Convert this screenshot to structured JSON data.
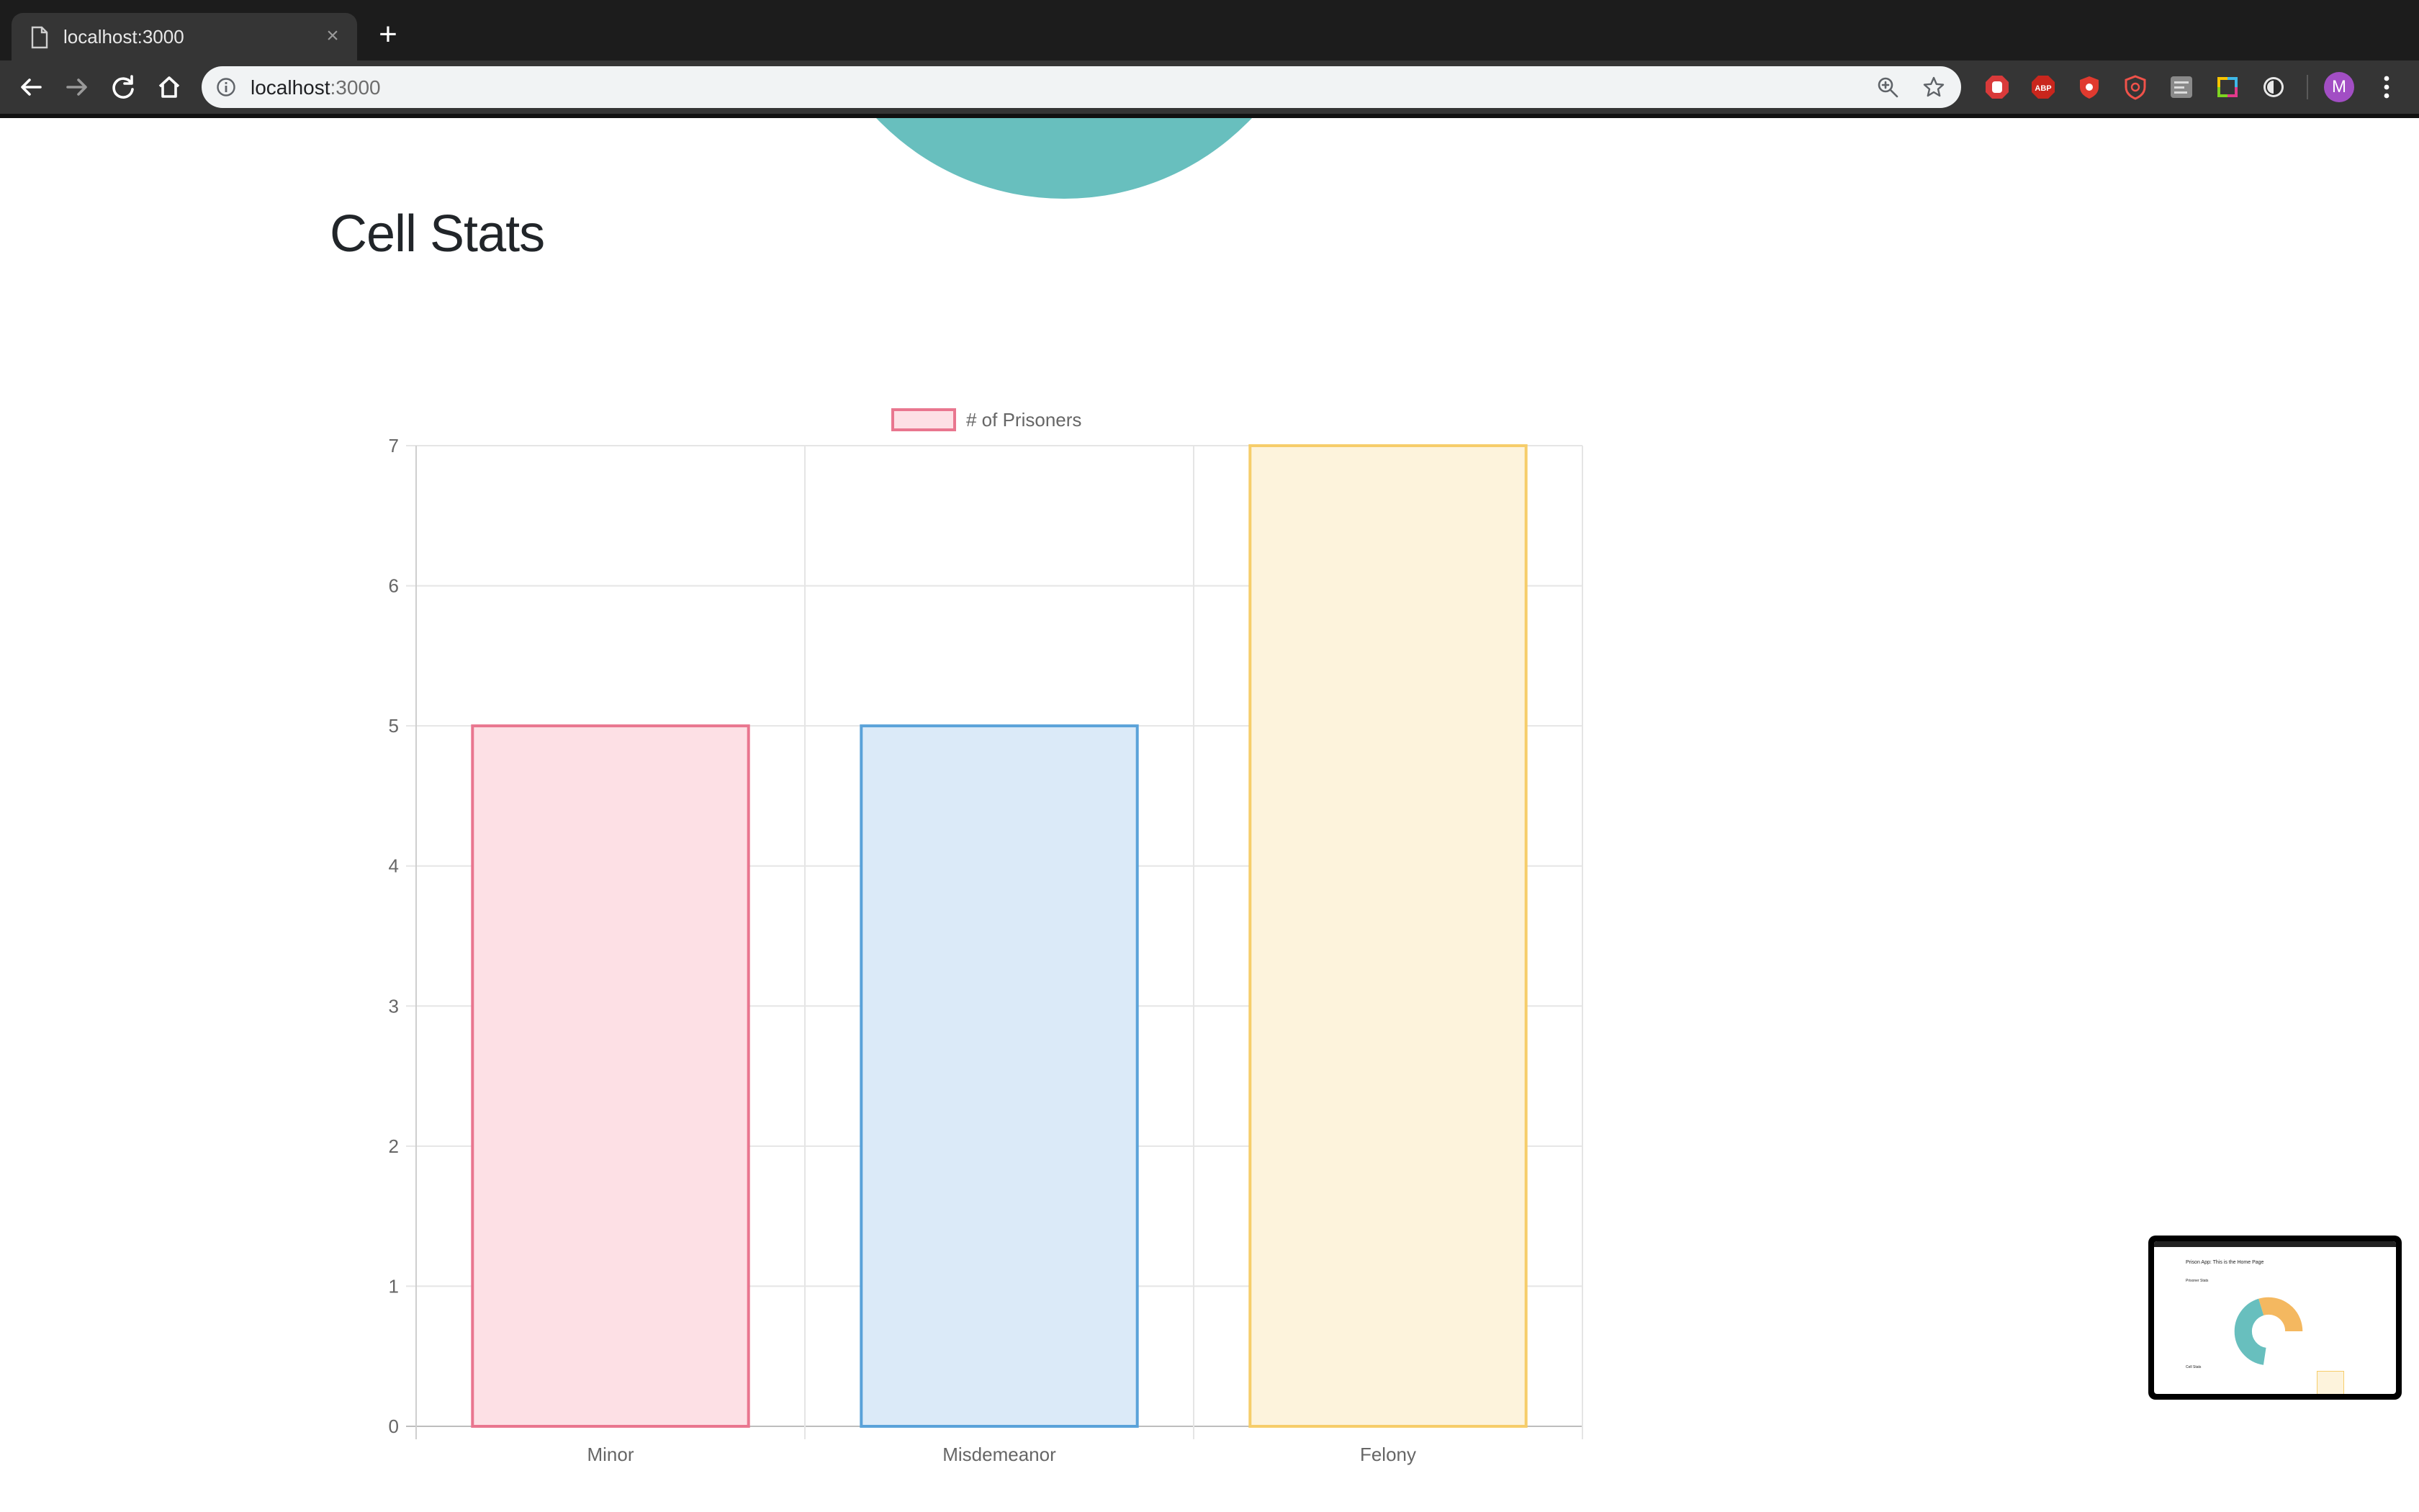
{
  "browser": {
    "tab_title": "localhost:3000",
    "url_host": "localhost",
    "url_port": ":3000",
    "extensions": [
      "stop-sign-icon",
      "adblock-plus-icon",
      "shield-red-icon",
      "shield-outline-icon",
      "json-viewer-icon",
      "color-picker-icon",
      "dark-mode-icon"
    ],
    "profile_initial": "M"
  },
  "page": {
    "heading": "Cell Stats"
  },
  "chart_data": {
    "type": "bar",
    "categories": [
      "Minor",
      "Misdemeanor",
      "Felony"
    ],
    "series": [
      {
        "name": "# of Prisoners",
        "values": [
          5,
          5,
          7
        ],
        "fill_colors": [
          "#fde0e5",
          "#dbeaf8",
          "#fdf3dc"
        ],
        "border_colors": [
          "#e9768f",
          "#5aa2d9",
          "#f6cd6a"
        ]
      }
    ],
    "ylim": [
      0,
      7
    ],
    "yticks": [
      0,
      1,
      2,
      3,
      4,
      5,
      6,
      7
    ],
    "grid": true,
    "legend_position": "top"
  },
  "thumbnail": {
    "title": "Prison App: This is the Home Page",
    "section1": "Prisoner Stats",
    "section2": "Cell Stats"
  },
  "colors": {
    "donut_teal": "#68bfbe"
  }
}
